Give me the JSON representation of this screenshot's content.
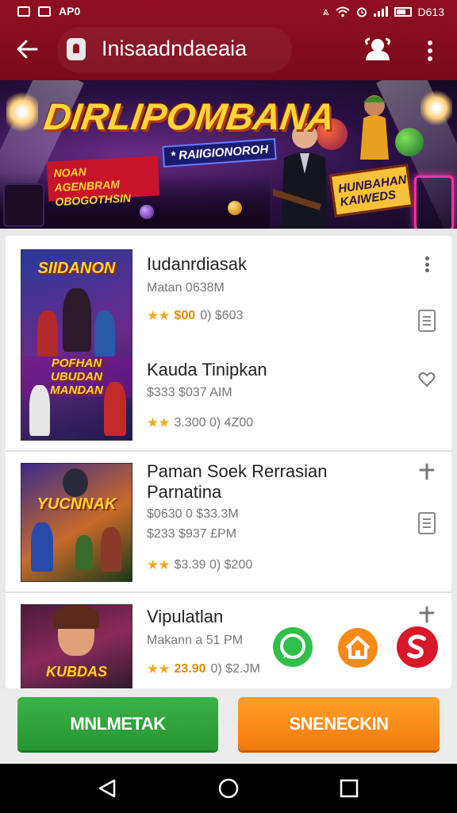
{
  "status_bar": {
    "left_text": "AP0",
    "right_text": "D613"
  },
  "app_bar": {
    "title": "Inisaadndaeaia",
    "icons": [
      "back-arrow-icon",
      "lock-icon",
      "avatar-icon",
      "more-vert-icon"
    ]
  },
  "banner": {
    "headline": "DIRLIPOMBANA",
    "tag_red": "NOAN AGENBRAM\nOBOGOTHSIN",
    "tag_blue": "* RAIIGIONOROH",
    "tag_yellow": "HUNBAHAN\nKAIWEDS"
  },
  "items": [
    {
      "thumb_title": "SIIDANON",
      "thumb_subtitle": "POFHAN\nUBUDAN\nMANDAN",
      "name": "Iudanrdiasak",
      "subtitle": "Matan 0638M",
      "rating_stars": "★★",
      "price_highlight": "$00",
      "meta_rest": "0) $603",
      "name2": "Kauda Tinipkan",
      "subtitle2": "$333 $037 AIM",
      "rating_stars2": "★★",
      "meta2": "3.300 0) 4Z00",
      "icons": [
        "more-vert-icon",
        "document-icon",
        "heart-icon"
      ]
    },
    {
      "thumb_title": "YUCNNAK",
      "name": "Paman Soek Rerrasian\nParnatina",
      "subtitle": "$0630 0 $33.3M",
      "subtitle_b": "$233 $937 £PM",
      "rating_stars": "★★",
      "meta": "$3.39 0) $200",
      "icons": [
        "pin-icon",
        "document-icon"
      ]
    },
    {
      "thumb_title": "KUBDAS",
      "name": "Vipulatlan",
      "subtitle": "Makann a 51 PM",
      "rating_stars": "★★",
      "price_highlight": "23.90",
      "meta_rest": "0) $2.JM",
      "icons": [
        "pin-icon"
      ]
    }
  ],
  "fabs": [
    "whatsapp-icon",
    "home-icon",
    "brand-s-icon"
  ],
  "buttons": {
    "primary": "MNLMETAK",
    "secondary": "SNENECKIN"
  },
  "nav": [
    "back-triangle-icon",
    "home-circle-icon",
    "recents-square-icon"
  ],
  "colors": {
    "app_bar": "#8f1020",
    "primary_button": "#2ea33b",
    "secondary_button": "#f58a18",
    "star": "#f3a81e"
  }
}
